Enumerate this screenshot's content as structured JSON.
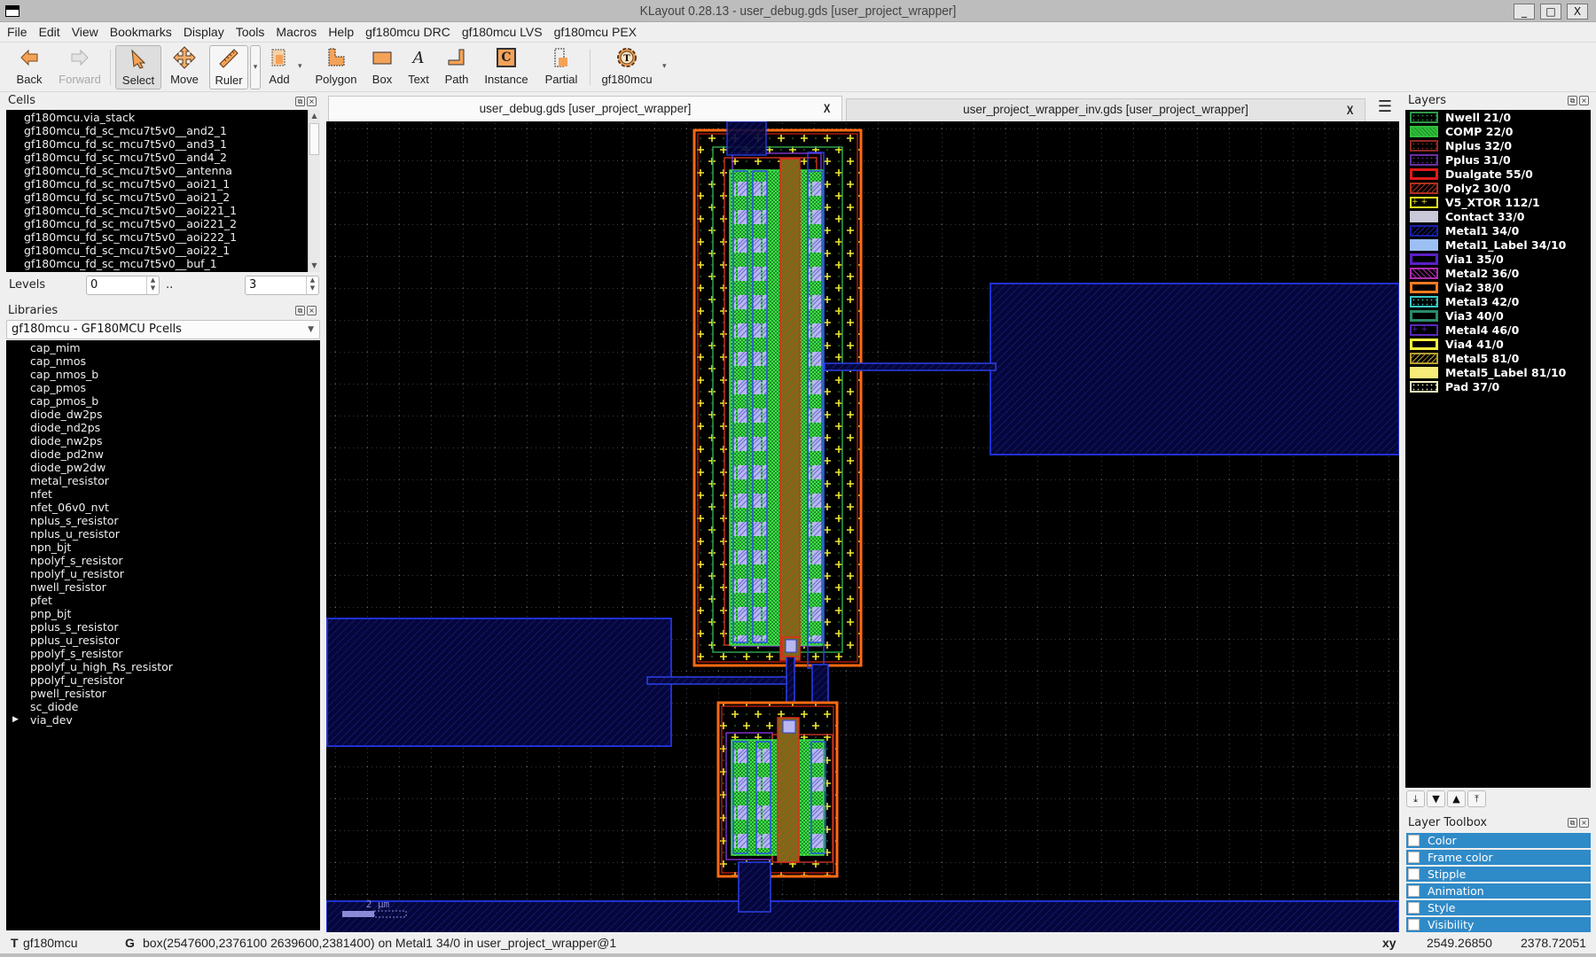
{
  "window": {
    "title": "KLayout 0.28.13 - user_debug.gds [user_project_wrapper]",
    "minimize": "_",
    "maximize": "□",
    "close": "X"
  },
  "menu": [
    "File",
    "Edit",
    "View",
    "Bookmarks",
    "Display",
    "Tools",
    "Macros",
    "Help",
    "gf180mcu DRC",
    "gf180mcu LVS",
    "gf180mcu PEX"
  ],
  "toolbar": {
    "back": "Back",
    "forward": "Forward",
    "select": "Select",
    "move": "Move",
    "ruler": "Ruler",
    "add": "Add",
    "polygon": "Polygon",
    "box": "Box",
    "text": "Text",
    "path": "Path",
    "instance": "Instance",
    "partial": "Partial",
    "tech": "gf180mcu",
    "active_tool": "Select"
  },
  "cells_panel": {
    "title": "Cells",
    "items": [
      "gf180mcu.via_stack",
      "gf180mcu_fd_sc_mcu7t5v0__and2_1",
      "gf180mcu_fd_sc_mcu7t5v0__and3_1",
      "gf180mcu_fd_sc_mcu7t5v0__and4_2",
      "gf180mcu_fd_sc_mcu7t5v0__antenna",
      "gf180mcu_fd_sc_mcu7t5v0__aoi21_1",
      "gf180mcu_fd_sc_mcu7t5v0__aoi21_2",
      "gf180mcu_fd_sc_mcu7t5v0__aoi221_1",
      "gf180mcu_fd_sc_mcu7t5v0__aoi221_2",
      "gf180mcu_fd_sc_mcu7t5v0__aoi222_1",
      "gf180mcu_fd_sc_mcu7t5v0__aoi22_1",
      "gf180mcu_fd_sc_mcu7t5v0__buf_1"
    ],
    "levels_label": "Levels",
    "levels_from": "0",
    "levels_sep": "..",
    "levels_to": "3"
  },
  "libraries_panel": {
    "title": "Libraries",
    "selected_library": "gf180mcu - GF180MCU Pcells",
    "items": [
      "cap_mim",
      "cap_nmos",
      "cap_nmos_b",
      "cap_pmos",
      "cap_pmos_b",
      "diode_dw2ps",
      "diode_nd2ps",
      "diode_nw2ps",
      "diode_pd2nw",
      "diode_pw2dw",
      "metal_resistor",
      "nfet",
      "nfet_06v0_nvt",
      "nplus_s_resistor",
      "nplus_u_resistor",
      "npn_bjt",
      "npolyf_s_resistor",
      "npolyf_u_resistor",
      "nwell_resistor",
      "pfet",
      "pnp_bjt",
      "pplus_s_resistor",
      "pplus_u_resistor",
      "ppolyf_s_resistor",
      "ppolyf_u_high_Rs_resistor",
      "ppolyf_u_resistor",
      "pwell_resistor",
      "sc_diode"
    ],
    "expandable_item": "via_dev"
  },
  "tabs": [
    {
      "label": "user_debug.gds [user_project_wrapper]",
      "active": true,
      "close": "X"
    },
    {
      "label": "user_project_wrapper_inv.gds [user_project_wrapper]",
      "active": false,
      "close": "X"
    }
  ],
  "canvas": {
    "scale_bar_label": "2 µm"
  },
  "layers_panel": {
    "title": "Layers",
    "layers": [
      {
        "name": "Nwell 21/0",
        "color": "#2e9a4a",
        "fill": "dots"
      },
      {
        "name": "COMP 22/0",
        "color": "#2fbf3a",
        "fill": "solid-hatch"
      },
      {
        "name": "Nplus 32/0",
        "color": "#8f2a20",
        "fill": "dots"
      },
      {
        "name": "Pplus 31/0",
        "color": "#6a2fa0",
        "fill": "dots"
      },
      {
        "name": "Dualgate 55/0",
        "color": "#e01a1a",
        "fill": "frame"
      },
      {
        "name": "Poly2 30/0",
        "color": "#b0301e",
        "fill": "hatch"
      },
      {
        "name": "V5_XTOR 112/1",
        "color": "#e8e020",
        "fill": "cross"
      },
      {
        "name": "Contact 33/0",
        "color": "#c8c8d8",
        "fill": "solid"
      },
      {
        "name": "Metal1 34/0",
        "color": "#1a20a8",
        "fill": "hatch"
      },
      {
        "name": "Metal1_Label 34/10",
        "color": "#9cc0f4",
        "fill": "solid"
      },
      {
        "name": "Via1 35/0",
        "color": "#5a20c8",
        "fill": "frame"
      },
      {
        "name": "Metal2 36/0",
        "color": "#b02cb0",
        "fill": "hatch-back"
      },
      {
        "name": "Via2 38/0",
        "color": "#f07a20",
        "fill": "frame"
      },
      {
        "name": "Metal3 42/0",
        "color": "#3ac8c8",
        "fill": "dots"
      },
      {
        "name": "Via3 40/0",
        "color": "#2a8a6a",
        "fill": "frame"
      },
      {
        "name": "Metal4 46/0",
        "color": "#5828b8",
        "fill": "cross"
      },
      {
        "name": "Via4 41/0",
        "color": "#f4f040",
        "fill": "frame"
      },
      {
        "name": "Metal5 81/0",
        "color": "#b8a030",
        "fill": "hatch"
      },
      {
        "name": "Metal5_Label 81/10",
        "color": "#f8ec78",
        "fill": "solid"
      },
      {
        "name": "Pad 37/0",
        "color": "#f4f0c0",
        "fill": "dots"
      }
    ],
    "order_buttons": [
      "move-to-bottom",
      "move-down",
      "move-up",
      "move-to-top"
    ]
  },
  "layer_toolbox": {
    "title": "Layer Toolbox",
    "sections": [
      "Color",
      "Frame color",
      "Stipple",
      "Animation",
      "Style",
      "Visibility"
    ]
  },
  "status_bar": {
    "tech_prefix": "T",
    "tech": "gf180mcu",
    "grid_prefix": "G",
    "selection_info": "box(2547600,2376100 2639600,2381400) on Metal1 34/0 in user_project_wrapper@1",
    "coord_label": "xy",
    "x": "2549.26850",
    "y": "2378.72051"
  },
  "colors": {
    "selection_blue": "#2f8ac8",
    "canvas_bg": "#000000",
    "metal1": "#1a20a8",
    "v5xtor": "#e8e020",
    "dualgate": "#ff3a10"
  }
}
